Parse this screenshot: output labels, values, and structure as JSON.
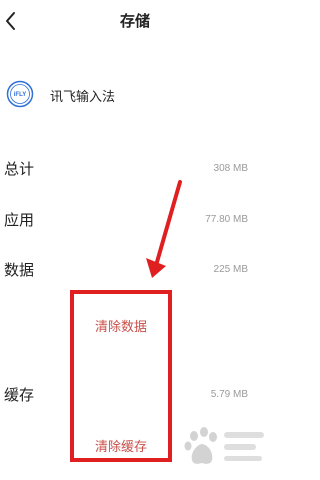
{
  "header": {
    "title": "存储"
  },
  "app": {
    "name": "讯飞输入法",
    "icon_text": "iFLY"
  },
  "storage": {
    "rows": [
      {
        "label": "总计",
        "value": "308 MB"
      },
      {
        "label": "应用",
        "value": "77.80 MB"
      },
      {
        "label": "数据",
        "value": "225 MB"
      },
      {
        "label": "缓存",
        "value": "5.79 MB"
      }
    ],
    "clear_data_label": "清除数据",
    "clear_cache_label": "清除缓存"
  },
  "colors": {
    "highlight": "#e02020",
    "action_text": "#c8504a",
    "value_text": "#9a9a9a"
  }
}
